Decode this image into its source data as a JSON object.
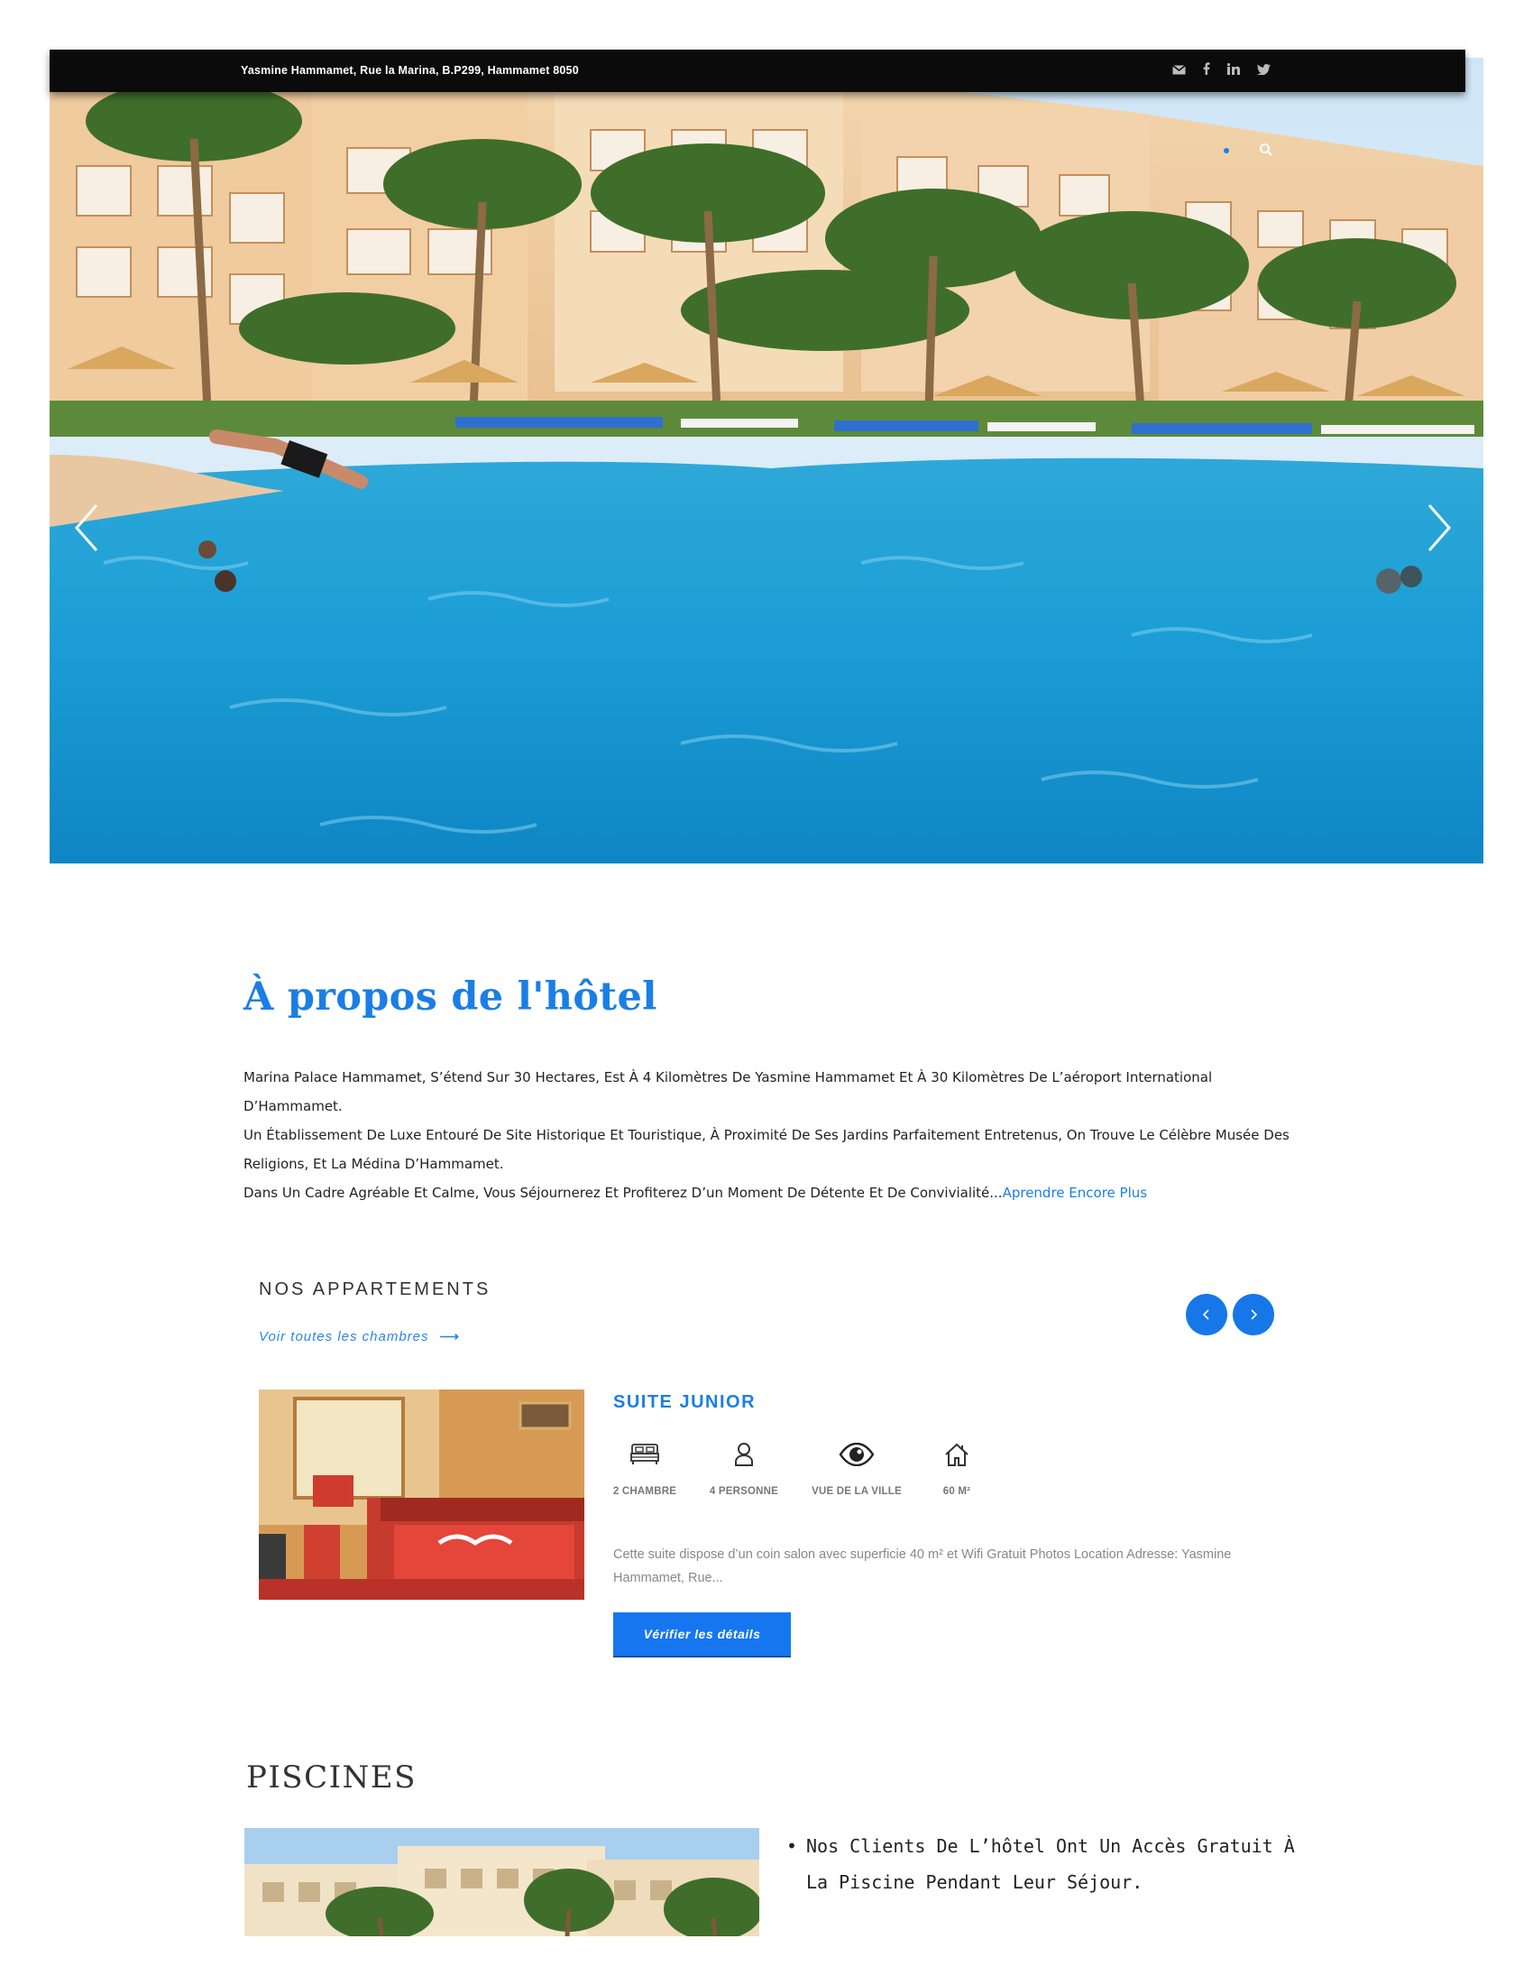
{
  "topbar": {
    "address": "Yasmine Hammamet, Rue la Marina, B.P299, Hammamet 8050",
    "social_icons": [
      "envelope-icon",
      "facebook-icon",
      "linkedin-icon",
      "twitter-icon"
    ]
  },
  "hero": {
    "image_description_icon": "hotel-pool-photo",
    "controls": [
      "chevron-left-icon",
      "chevron-right-icon",
      "search-icon"
    ]
  },
  "about": {
    "title": "À propos de l'hôtel",
    "line1": "Marina Palace Hammamet, S’étend Sur 30 Hectares, Est À 4 Kilomètres De Yasmine Hammamet Et À 30 Kilomètres De L’aéroport International D’Hammamet.",
    "line2": "Un Établissement De Luxe Entouré De Site Historique Et Touristique, À Proximité De Ses Jardins Parfaitement Entretenus, On Trouve Le Célèbre Musée Des Religions, Et La Médina D’Hammamet.",
    "line3": "Dans Un Cadre Agréable Et Calme, Vous Séjournerez Et Profiterez D’un Moment De Détente Et De Convivialité...",
    "more_link": "Aprendre Encore Plus"
  },
  "apartments": {
    "heading": "NOS APPARTEMENTS",
    "all_rooms_link": "Voir toutes les chambres",
    "room": {
      "title": "SUITE JUNIOR",
      "features": [
        {
          "icon": "bed-icon",
          "label": "2 CHAMBRE"
        },
        {
          "icon": "person-icon",
          "label": "4 PERSONNE"
        },
        {
          "icon": "eye-icon",
          "label": "VUE DE LA VILLE"
        },
        {
          "icon": "home-icon",
          "label": "60 M²"
        }
      ],
      "description": "Cette suite dispose d’un coin salon avec superficie 40 m² et Wifi Gratuit Photos Location Adresse: Yasmine Hammamet, Rue...",
      "button": "Vérifier les détails"
    },
    "accent": "#1677e8"
  },
  "pools": {
    "title": "PISCINES",
    "items": [
      "Nos Clients De L’hôtel Ont Un Accès Gratuit À La Piscine Pendant Leur Séjour."
    ]
  }
}
